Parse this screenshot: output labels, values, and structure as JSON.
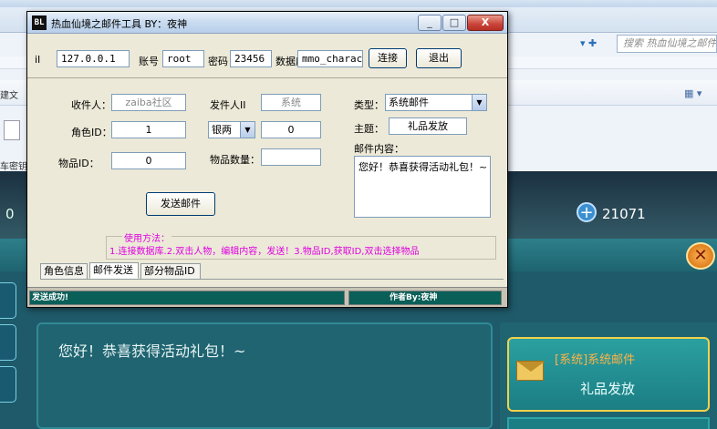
{
  "background": {
    "search_placeholder": "搜索 热血仙境之邮件",
    "side_text_1": "建文",
    "side_text_2": "车密钥",
    "game_left_value": "0",
    "game_currency": "21071",
    "mail_body": "您好！恭喜获得活动礼包！~",
    "mail_card_title": "[系统]系统邮件",
    "mail_card_subtitle": "礼品发放"
  },
  "window": {
    "icon_text": "BL",
    "title": "热血仙境之邮件工具    BY：夜神",
    "minimize": "_",
    "maximize": "□",
    "close": "X"
  },
  "connection": {
    "ip_label": "iI",
    "ip_value": "127.0.0.1",
    "account_label": "账号",
    "account_value": "root",
    "password_label": "密码",
    "password_value": "23456",
    "database_label": "数据库",
    "database_value": "mmo_charact",
    "connect_button": "连接",
    "exit_button": "退出"
  },
  "mail_form": {
    "recipient_label": "收件人：",
    "recipient_value": "zaiba社区",
    "sender_label": "发件人II",
    "sender_value": "系统",
    "role_id_label": "角色ID：",
    "role_id_value": "1",
    "currency_selected": "银两",
    "currency_amount": "0",
    "item_id_label": "物品ID：",
    "item_id_value": "0",
    "item_qty_label": "物品数量：",
    "item_qty_value": "",
    "type_label": "类型：",
    "type_selected": "系统邮件",
    "subject_label": "主题：",
    "subject_value": "礼品发放",
    "content_label": "邮件内容：",
    "content_value": "您好！恭喜获得活动礼包！~",
    "send_button": "发送邮件"
  },
  "usage": {
    "title": "使用方法：",
    "text": "1.连接数据库.2.双击人物，编辑内容，发送！3.物品ID,获取ID,双击选择物品"
  },
  "tabs": [
    {
      "label": "角色信息"
    },
    {
      "label": "邮件发送"
    },
    {
      "label": "部分物品ID"
    }
  ],
  "status": {
    "left": "发送成功!",
    "right": "作者By:夜神"
  }
}
